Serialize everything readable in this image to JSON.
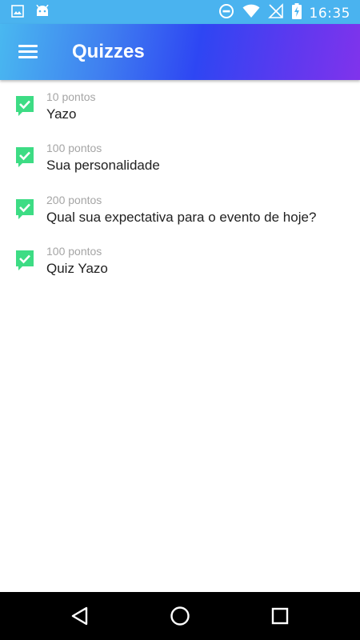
{
  "status_bar": {
    "time": "16:35",
    "left_icons": [
      "image-icon",
      "android-icon"
    ],
    "right_icons": [
      "do-not-disturb-icon",
      "wifi-icon",
      "no-signal-icon",
      "battery-charging-icon"
    ]
  },
  "app_bar": {
    "title": "Quizzes",
    "menu_icon": "hamburger-menu-icon"
  },
  "quizzes": [
    {
      "points": "10 pontos",
      "title": "Yazo"
    },
    {
      "points": "100 pontos",
      "title": "Sua personalidade"
    },
    {
      "points": "200 pontos",
      "title": "Qual sua expectativa para o evento de hoje?"
    },
    {
      "points": "100 pontos",
      "title": "Quiz Yazo"
    }
  ],
  "nav_bar": {
    "icons": [
      "back-icon",
      "home-icon",
      "recents-icon"
    ]
  },
  "colors": {
    "status_bar": "#4ab3ef",
    "app_bar_gradient_start": "#49b8f0",
    "app_bar_gradient_mid": "#2e46f3",
    "app_bar_gradient_end": "#8033ec",
    "quiz_icon_green": "#3ddc84",
    "points_text": "#a5a5a5",
    "title_text": "#212121"
  }
}
